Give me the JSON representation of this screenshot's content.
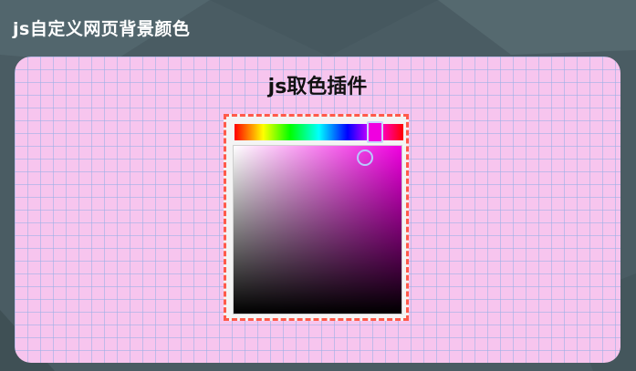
{
  "header": {
    "title": "js自定义网页背景颜色"
  },
  "panel": {
    "title": "js取色插件"
  },
  "picker": {
    "selected_color": "#f000e0",
    "hue_position": 0.83,
    "saturation": 0.78,
    "brightness": 0.93
  },
  "colors": {
    "page_background": "#4a5c63",
    "panel_background": "#f7c5ee",
    "grid_lines": "#96afe6",
    "picker_border": "#ff5a4a"
  }
}
